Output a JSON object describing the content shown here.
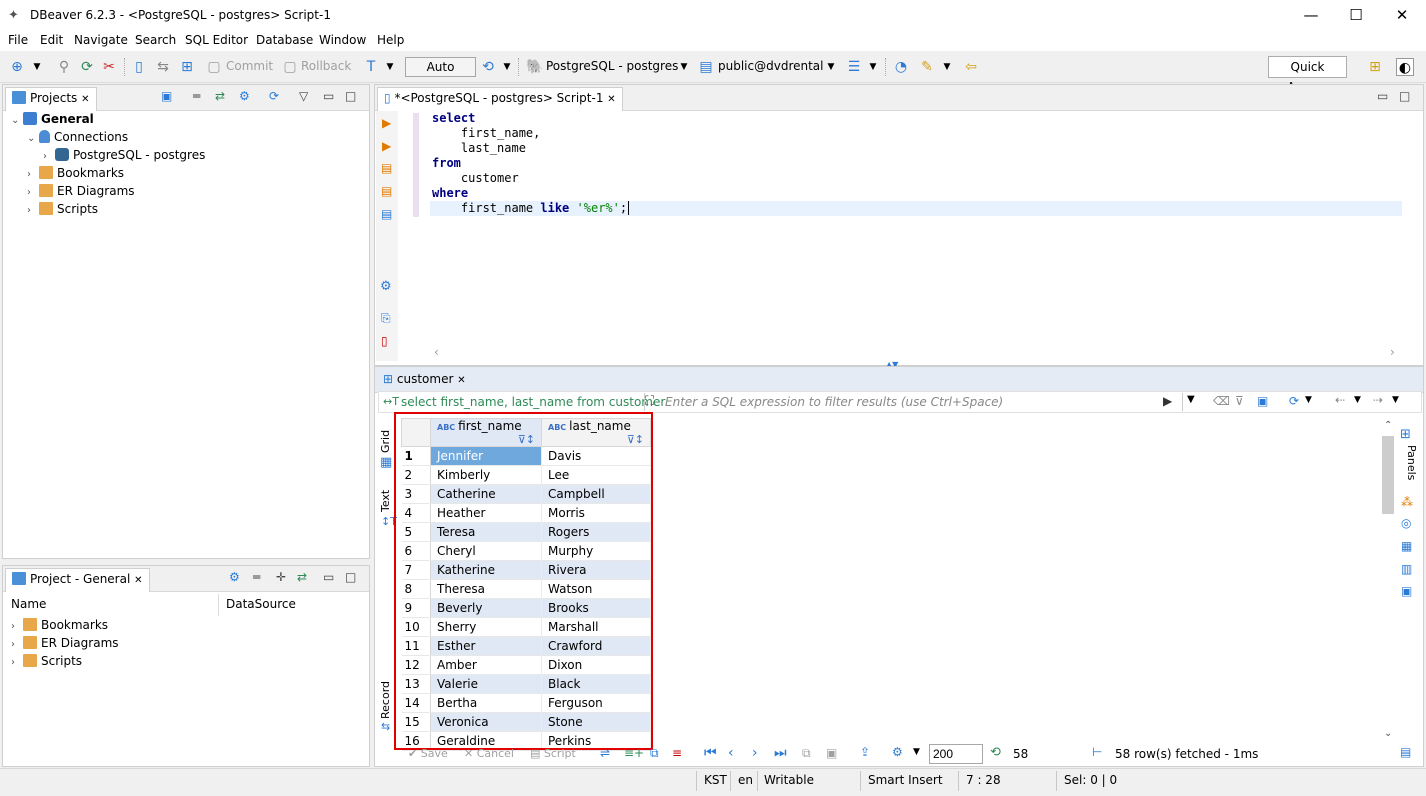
{
  "window": {
    "title": "DBeaver 6.2.3 - <PostgreSQL - postgres> Script-1",
    "minimize": "—",
    "maximize": "☐",
    "close": "✕"
  },
  "menu": [
    "File",
    "Edit",
    "Navigate",
    "Search",
    "SQL Editor",
    "Database",
    "Window",
    "Help"
  ],
  "toolbar": {
    "commit": "Commit",
    "rollback": "Rollback",
    "transaction_mode": "Auto",
    "connection": "PostgreSQL - postgres",
    "schema": "public@dvdrental",
    "quick_access": "Quick Access"
  },
  "projects_panel": {
    "tab": "Projects",
    "items": [
      {
        "label": "General"
      },
      {
        "label": "Connections"
      },
      {
        "label": "PostgreSQL - postgres"
      },
      {
        "label": "Bookmarks"
      },
      {
        "label": "ER Diagrams"
      },
      {
        "label": "Scripts"
      }
    ]
  },
  "project_general_panel": {
    "tab": "Project - General",
    "columns": [
      "Name",
      "DataSource"
    ],
    "items": [
      {
        "label": "Bookmarks"
      },
      {
        "label": "ER Diagrams"
      },
      {
        "label": "Scripts"
      }
    ]
  },
  "editor": {
    "tab": "*<PostgreSQL - postgres> Script-1",
    "lines": [
      {
        "kw": "select",
        "rest": ""
      },
      {
        "kw": "",
        "rest": "    first_name,"
      },
      {
        "kw": "",
        "rest": "    last_name"
      },
      {
        "kw": "from",
        "rest": ""
      },
      {
        "kw": "",
        "rest": "    customer"
      },
      {
        "kw": "where",
        "rest": ""
      }
    ],
    "last_line": {
      "pre": "    first_name ",
      "kw": "like",
      "sp": " ",
      "str": "'%er%'",
      "post": ";"
    }
  },
  "results": {
    "tab": "customer",
    "query_label": "select first_name, last_name from customer",
    "filter_placeholder": "Enter a SQL expression to filter results (use Ctrl+Space)",
    "side_tabs": {
      "grid": "Grid",
      "text": "Text",
      "record": "Record"
    },
    "right_tab": "Panels",
    "columns": [
      "first_name",
      "last_name"
    ],
    "rows": [
      [
        "1",
        "Jennifer",
        "Davis"
      ],
      [
        "2",
        "Kimberly",
        "Lee"
      ],
      [
        "3",
        "Catherine",
        "Campbell"
      ],
      [
        "4",
        "Heather",
        "Morris"
      ],
      [
        "5",
        "Teresa",
        "Rogers"
      ],
      [
        "6",
        "Cheryl",
        "Murphy"
      ],
      [
        "7",
        "Katherine",
        "Rivera"
      ],
      [
        "8",
        "Theresa",
        "Watson"
      ],
      [
        "9",
        "Beverly",
        "Brooks"
      ],
      [
        "10",
        "Sherry",
        "Marshall"
      ],
      [
        "11",
        "Esther",
        "Crawford"
      ],
      [
        "12",
        "Amber",
        "Dixon"
      ],
      [
        "13",
        "Valerie",
        "Black"
      ],
      [
        "14",
        "Bertha",
        "Ferguson"
      ],
      [
        "15",
        "Veronica",
        "Stone"
      ],
      [
        "16",
        "Geraldine",
        "Perkins"
      ]
    ],
    "bottom": {
      "save": "Save",
      "cancel": "Cancel",
      "script": "Script",
      "fetch_size": "200",
      "refresh_count": "58",
      "status": "58 row(s) fetched - 1ms"
    }
  },
  "statusbar": {
    "timezone": "KST",
    "locale": "en",
    "mode": "Writable",
    "insert": "Smart Insert",
    "position": "7 : 28",
    "selection": "Sel: 0 | 0"
  }
}
